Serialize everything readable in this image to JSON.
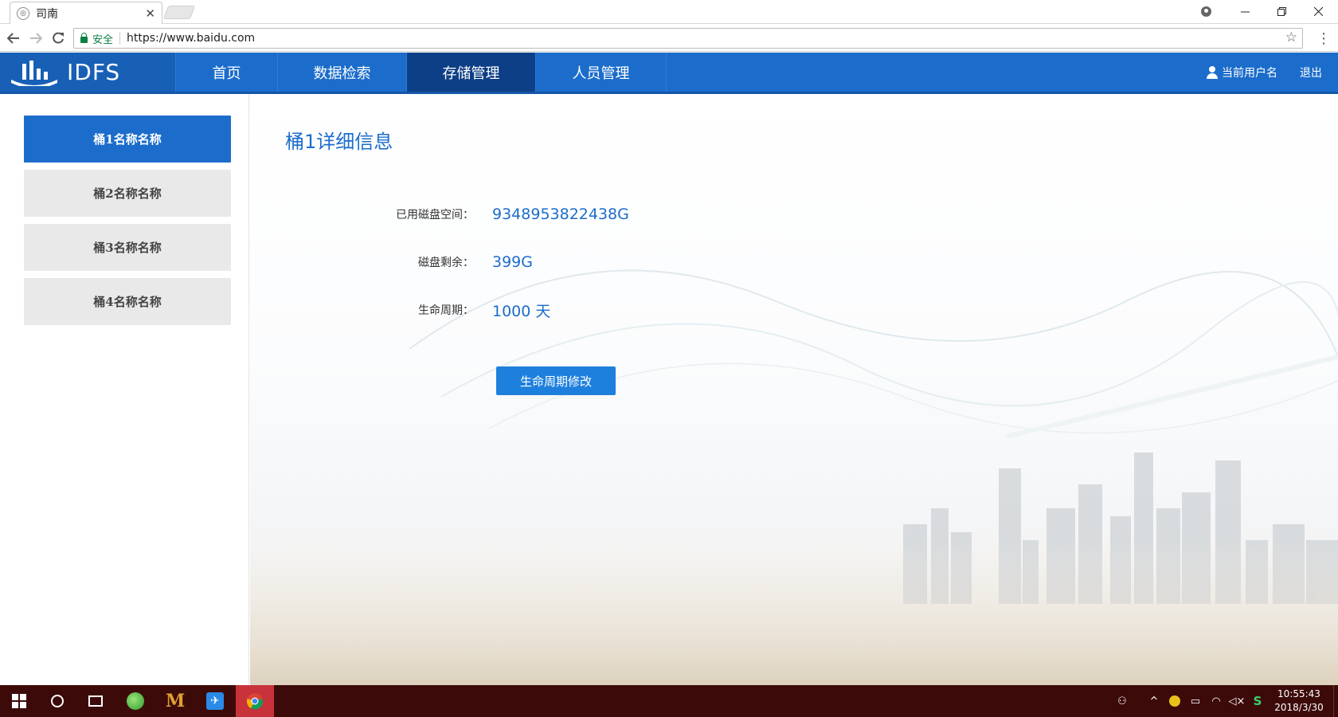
{
  "browser": {
    "tab_title": "司南",
    "tab_close": "✕",
    "secure_label": "安全",
    "url": "https://www.baidu.com"
  },
  "header": {
    "logo_text": "IDFS",
    "nav": [
      {
        "label": "首页",
        "active": false
      },
      {
        "label": "数据检索",
        "active": false
      },
      {
        "label": "存储管理",
        "active": true
      },
      {
        "label": "人员管理",
        "active": false
      }
    ],
    "user_name": "当前用户名",
    "logout_label": "退出"
  },
  "sidebar": {
    "items": [
      {
        "label": "桶1名称名称",
        "active": true
      },
      {
        "label": "桶2名称名称",
        "active": false
      },
      {
        "label": "桶3名称名称",
        "active": false
      },
      {
        "label": "桶4名称名称",
        "active": false
      }
    ]
  },
  "detail": {
    "title": "桶1详细信息",
    "rows": [
      {
        "label": "已用磁盘空间：",
        "value": "9348953822438G"
      },
      {
        "label": "磁盘剩余：",
        "value": "399G"
      },
      {
        "label": "生命周期：",
        "value": "1000 天"
      }
    ],
    "modify_button": "生命周期修改"
  },
  "taskbar": {
    "time": "10:55:43",
    "date": "2018/3/30"
  },
  "colors": {
    "brand_blue": "#1c6dcb",
    "nav_active": "#0d3f86",
    "taskbar": "#3d0a0a"
  }
}
